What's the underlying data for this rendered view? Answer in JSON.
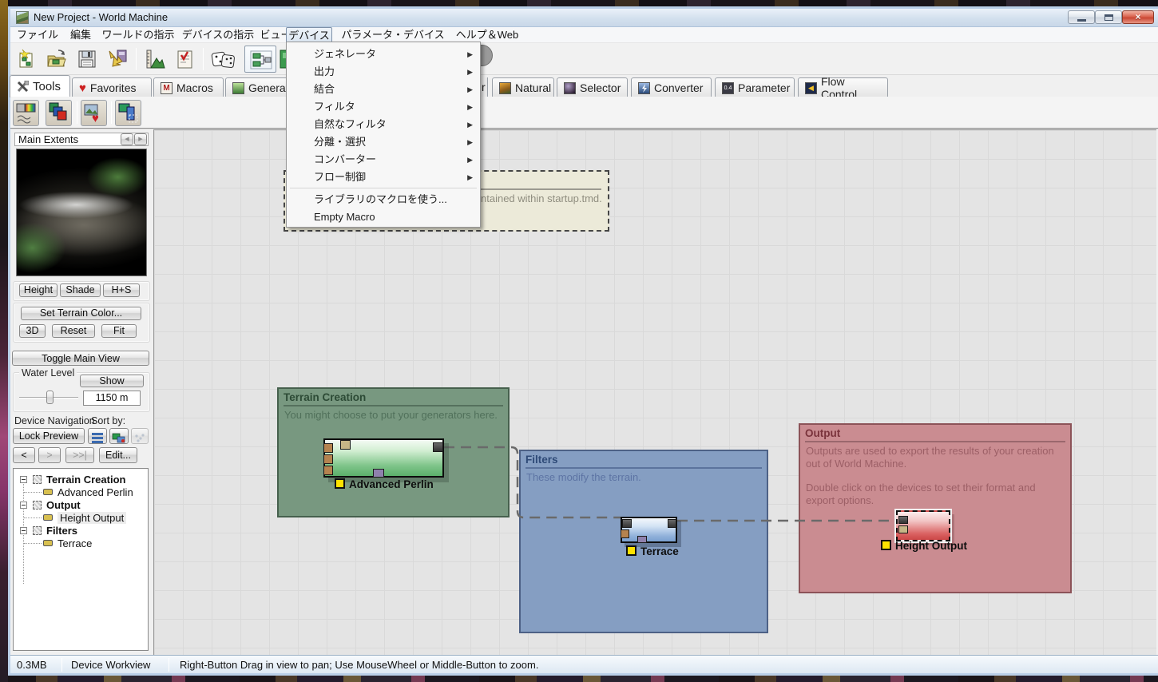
{
  "colors": {
    "group_terrain": "#709278",
    "group_filters": "#7e99c0",
    "group_output": "#c8858b",
    "device_label_marker": "#ffe200",
    "wire": "#6a6a6a"
  },
  "window": {
    "title": "New Project - World Machine"
  },
  "menubar": {
    "items": [
      "ファイル",
      "編集",
      "ワールドの指示",
      "デバイスの指示",
      "ビュー",
      "デバイス",
      "パラメータ・デバイス",
      "ヘルプ＆Web"
    ],
    "active_item": "デバイス"
  },
  "toolbar": {
    "icons": [
      "new-project",
      "open-project",
      "save",
      "import-device",
      "world-size",
      "project-settings",
      "random-seed",
      "device-workview",
      "clipped-icon",
      "partial-circle-icon"
    ]
  },
  "device_menu": {
    "items": [
      "ジェネレータ",
      "出力",
      "結合",
      "フィルタ",
      "自然なフィルタ",
      "分離・選択",
      "コンバーター",
      "フロー制御"
    ],
    "submenu_arrow": "▶",
    "footer_items": [
      "ライブラリのマクロを使う...",
      "Empty Macro"
    ]
  },
  "tabs": {
    "active": "Tools",
    "items_left": [
      "Tools",
      "Favorites",
      "Macros",
      "Generator"
    ],
    "hidden_fragment": "r",
    "items_right": [
      "Natural",
      "Selector",
      "Converter",
      "Parameter",
      "Flow Control"
    ]
  },
  "sidebar": {
    "extents_title": "Main Extents",
    "spin_left": "◀",
    "spin_right": "▶",
    "view_mode_buttons": [
      "Height",
      "Shade",
      "H+S"
    ],
    "terrain_color_button": "Set Terrain Color...",
    "view_buttons": [
      "3D",
      "Reset",
      "Fit"
    ],
    "toggle_main_view_button": "Toggle Main View",
    "water_level": {
      "label": "Water Level",
      "show_button": "Show",
      "value": "1150 m"
    },
    "device_navigation": {
      "label": "Device Navigation",
      "sort_label": "Sort by:",
      "lock_preview_button": "Lock Preview",
      "nav_prev": "<",
      "nav_next": ">",
      "nav_last": ">>|",
      "edit_button": "Edit..."
    },
    "tree": {
      "groups": [
        {
          "label": "Terrain Creation",
          "child": "Advanced Perlin"
        },
        {
          "label": "Output",
          "child": "Height Output"
        },
        {
          "label": "Filters",
          "child": "Terrace"
        }
      ]
    }
  },
  "canvas": {
    "note_fragment": "ntained within startup.tmd.",
    "groups": [
      {
        "title": "Terrain Creation",
        "description": "You might choose to put your generators here."
      },
      {
        "title": "Filters",
        "description": "These modify the terrain."
      },
      {
        "title": "Output",
        "description": "Outputs are used to export the results of your creation out of World Machine.",
        "description2": "Double click on the devices to set their format and export options."
      }
    ],
    "devices": [
      {
        "label": "Advanced Perlin"
      },
      {
        "label": "Terrace"
      },
      {
        "label": "Height Output",
        "selected": true
      }
    ]
  },
  "statusbar": {
    "memory": "0.3MB",
    "view_name": "Device Workview",
    "hint": "Right-Button Drag in view to pan; Use MouseWheel or Middle-Button to zoom."
  }
}
